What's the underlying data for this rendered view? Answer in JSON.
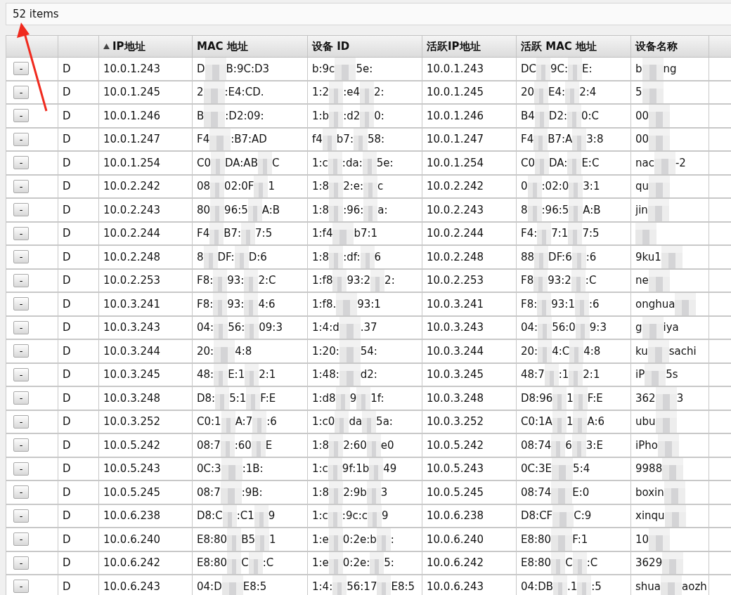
{
  "summary": "52 items",
  "columns": [
    {
      "sorted": false
    },
    {
      "sorted": false
    },
    {
      "label": "IP地址",
      "sorted": true
    },
    {
      "label": "MAC 地址",
      "sorted": false
    },
    {
      "label": "设备 ID",
      "sorted": false
    },
    {
      "label": "活跃IP地址",
      "sorted": false
    },
    {
      "label": "活跃 MAC 地址",
      "sorted": false
    },
    {
      "label": "设备名称",
      "sorted": false
    }
  ],
  "rows": [
    {
      "button": "-",
      "flag": "D",
      "ip": "10.0.1.243",
      "mac": [
        "D",
        "B:9C:D3"
      ],
      "device_id": [
        "b:9c",
        "5e:"
      ],
      "active_ip": "10.0.1.243",
      "active_mac": [
        "DC",
        "9C:",
        "E:"
      ],
      "name": [
        "b",
        "ng"
      ]
    },
    {
      "button": "-",
      "flag": "D",
      "ip": "10.0.1.245",
      "mac": [
        "2",
        ":E4:CD."
      ],
      "device_id": [
        "1:2",
        ":e4",
        "2:"
      ],
      "active_ip": "10.0.1.245",
      "active_mac": [
        "20",
        "E4:",
        "2:4"
      ],
      "name": [
        "5"
      ]
    },
    {
      "button": "-",
      "flag": "D",
      "ip": "10.0.1.246",
      "mac": [
        "B",
        ":D2:09:"
      ],
      "device_id": [
        "1:b",
        ":d2",
        "0:"
      ],
      "active_ip": "10.0.1.246",
      "active_mac": [
        "B4",
        "D2:",
        "0:C"
      ],
      "name": [
        "00"
      ]
    },
    {
      "button": "-",
      "flag": "D",
      "ip": "10.0.1.247",
      "mac": [
        "F4",
        ":B7:AD"
      ],
      "device_id": [
        "f4",
        "b7:",
        "58:"
      ],
      "active_ip": "10.0.1.247",
      "active_mac": [
        "F4",
        "B7:A",
        "3:8"
      ],
      "name": [
        "00"
      ]
    },
    {
      "button": "-",
      "flag": "D",
      "ip": "10.0.1.254",
      "mac": [
        "C0",
        "DA:AB",
        "C"
      ],
      "device_id": [
        "1:c",
        ":da:",
        "5e:"
      ],
      "active_ip": "10.0.1.254",
      "active_mac": [
        "C0",
        "DA:",
        "E:C"
      ],
      "name": [
        "nac",
        "-2"
      ]
    },
    {
      "button": "-",
      "flag": "D",
      "ip": "10.0.2.242",
      "mac": [
        "08",
        "02:0F",
        "1"
      ],
      "device_id": [
        "1:8",
        "2:e:",
        "c"
      ],
      "active_ip": "10.0.2.242",
      "active_mac": [
        "0",
        ":02:0",
        "3:1"
      ],
      "name": [
        "qu"
      ]
    },
    {
      "button": "-",
      "flag": "D",
      "ip": "10.0.2.243",
      "mac": [
        "80",
        "96:5",
        "A:B"
      ],
      "device_id": [
        "1:8",
        ":96:",
        "a:"
      ],
      "active_ip": "10.0.2.243",
      "active_mac": [
        "8",
        ":96:5",
        "A:B"
      ],
      "name": [
        "jin"
      ]
    },
    {
      "button": "-",
      "flag": "D",
      "ip": "10.0.2.244",
      "mac": [
        "F4",
        "B7:",
        "7:5"
      ],
      "device_id": [
        "1:f4",
        "b7:1"
      ],
      "active_ip": "10.0.2.244",
      "active_mac": [
        "F4:",
        "7:1",
        "7:5"
      ]
    },
    {
      "button": "-",
      "flag": "D",
      "ip": "10.0.2.248",
      "mac": [
        "8",
        "DF:",
        "D:6"
      ],
      "device_id": [
        "1:8",
        ":df:",
        "6"
      ],
      "active_ip": "10.0.2.248",
      "active_mac": [
        "88",
        "DF:6",
        ":6"
      ],
      "name": [
        "9ku1"
      ]
    },
    {
      "button": "-",
      "flag": "D",
      "ip": "10.0.2.253",
      "mac": [
        "F8:",
        "93:",
        "2:C"
      ],
      "device_id": [
        "1:f8",
        "93:2",
        "2:"
      ],
      "active_ip": "10.0.2.253",
      "active_mac": [
        "F8",
        "93:2",
        ":C"
      ],
      "name": [
        "ne"
      ]
    },
    {
      "button": "-",
      "flag": "D",
      "ip": "10.0.3.241",
      "mac": [
        "F8:",
        "93:",
        "4:6"
      ],
      "device_id": [
        "1:f8.",
        "93:1"
      ],
      "active_ip": "10.0.3.241",
      "active_mac": [
        "F8:",
        "93:1",
        ":6"
      ],
      "name": [
        "onghua"
      ]
    },
    {
      "button": "-",
      "flag": "D",
      "ip": "10.0.3.243",
      "mac": [
        "04:",
        "56:",
        "09:3"
      ],
      "device_id": [
        "1:4:d",
        ".37"
      ],
      "active_ip": "10.0.3.243",
      "active_mac": [
        "04:",
        "56:0",
        "9:3"
      ],
      "name": [
        "g",
        "iya"
      ]
    },
    {
      "button": "-",
      "flag": "D",
      "ip": "10.0.3.244",
      "mac": [
        "20:",
        "4:8"
      ],
      "device_id": [
        "1:20:",
        "54:"
      ],
      "active_ip": "10.0.3.244",
      "active_mac": [
        "20:",
        "4:C",
        "4:8"
      ],
      "name": [
        "ku",
        "sachi"
      ]
    },
    {
      "button": "-",
      "flag": "D",
      "ip": "10.0.3.245",
      "mac": [
        "48:",
        "E:1",
        "2:1"
      ],
      "device_id": [
        "1:48:",
        "d2:"
      ],
      "active_ip": "10.0.3.245",
      "active_mac": [
        "48:7",
        ":1",
        "2:1"
      ],
      "name": [
        "iP",
        "5s"
      ]
    },
    {
      "button": "-",
      "flag": "D",
      "ip": "10.0.3.248",
      "mac": [
        "D8:",
        "5:1",
        "F:E"
      ],
      "device_id": [
        "1:d8",
        "9",
        "1f:"
      ],
      "active_ip": "10.0.3.248",
      "active_mac": [
        "D8:96",
        "1",
        "F:E"
      ],
      "name": [
        "362",
        "3"
      ]
    },
    {
      "button": "-",
      "flag": "D",
      "ip": "10.0.3.252",
      "mac": [
        "C0:1",
        "A:7",
        ":6"
      ],
      "device_id": [
        "1:c0",
        "da",
        "5a:"
      ],
      "active_ip": "10.0.3.252",
      "active_mac": [
        "C0:1A",
        "1",
        "A:6"
      ],
      "name": [
        "ubu"
      ]
    },
    {
      "button": "-",
      "flag": "D",
      "ip": "10.0.5.242",
      "mac": [
        "08:7",
        ":60",
        "E"
      ],
      "device_id": [
        "1:8",
        "2:60",
        "e0"
      ],
      "active_ip": "10.0.5.242",
      "active_mac": [
        "08:74",
        "6",
        "3:E"
      ],
      "name": [
        "iPho"
      ]
    },
    {
      "button": "-",
      "flag": "D",
      "ip": "10.0.5.243",
      "mac": [
        "0C:3",
        ":1B:"
      ],
      "device_id": [
        "1:c",
        "9f:1b",
        "49"
      ],
      "active_ip": "10.0.5.243",
      "active_mac": [
        "0C:3E",
        "5:4"
      ],
      "name": [
        "9988"
      ]
    },
    {
      "button": "-",
      "flag": "D",
      "ip": "10.0.5.245",
      "mac": [
        "08:7",
        ":9B:"
      ],
      "device_id": [
        "1:8",
        "2:9b",
        "3"
      ],
      "active_ip": "10.0.5.245",
      "active_mac": [
        "08:74",
        "E:0"
      ],
      "name": [
        "boxin"
      ]
    },
    {
      "button": "-",
      "flag": "D",
      "ip": "10.0.6.238",
      "mac": [
        "D8:C",
        ":C1",
        "9"
      ],
      "device_id": [
        "1:c",
        ":9c:c",
        "9"
      ],
      "active_ip": "10.0.6.238",
      "active_mac": [
        "D8:CF",
        "C:9"
      ],
      "name": [
        "xinqu"
      ]
    },
    {
      "button": "-",
      "flag": "D",
      "ip": "10.0.6.240",
      "mac": [
        "E8:80",
        "B5",
        "1"
      ],
      "device_id": [
        "1:e",
        "0:2e:b",
        ":"
      ],
      "active_ip": "10.0.6.240",
      "active_mac": [
        "E8:80",
        "F:1"
      ],
      "name": [
        "10"
      ]
    },
    {
      "button": "-",
      "flag": "D",
      "ip": "10.0.6.242",
      "mac": [
        "E8:80",
        "C",
        ":C"
      ],
      "device_id": [
        "1:e",
        "0:2e:",
        "5:"
      ],
      "active_ip": "10.0.6.242",
      "active_mac": [
        "E8:80",
        "C",
        ":C"
      ],
      "name": [
        "3629"
      ]
    },
    {
      "button": "-",
      "flag": "D",
      "ip": "10.0.6.243",
      "mac": [
        "04:D",
        "E8:5"
      ],
      "device_id": [
        "1:4:",
        "56:17",
        "E8:5"
      ],
      "active_ip": "10.0.6.243",
      "active_mac": [
        "04:DB",
        ".1",
        ":5"
      ],
      "name": [
        "shua",
        "aozh"
      ]
    }
  ]
}
